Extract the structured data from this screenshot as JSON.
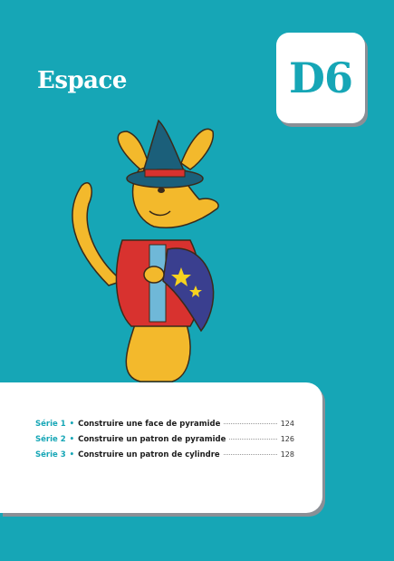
{
  "header": {
    "title": "Espace",
    "code": "D6"
  },
  "toc": {
    "rows": [
      {
        "serie": "Série 1",
        "bullet": "•",
        "topic": "Construire une face de pyramide",
        "page": "124"
      },
      {
        "serie": "Série 2",
        "bullet": "•",
        "topic": "Construire un patron de pyramide",
        "page": "126"
      },
      {
        "serie": "Série 3",
        "bullet": "•",
        "topic": "Construire un patron de cylindre",
        "page": "128"
      }
    ]
  },
  "colors": {
    "background": "#16a6b6",
    "accent": "#16a6b6",
    "card": "#ffffff"
  },
  "illustration": {
    "subject": "kangaroo-wizard-mascot"
  }
}
